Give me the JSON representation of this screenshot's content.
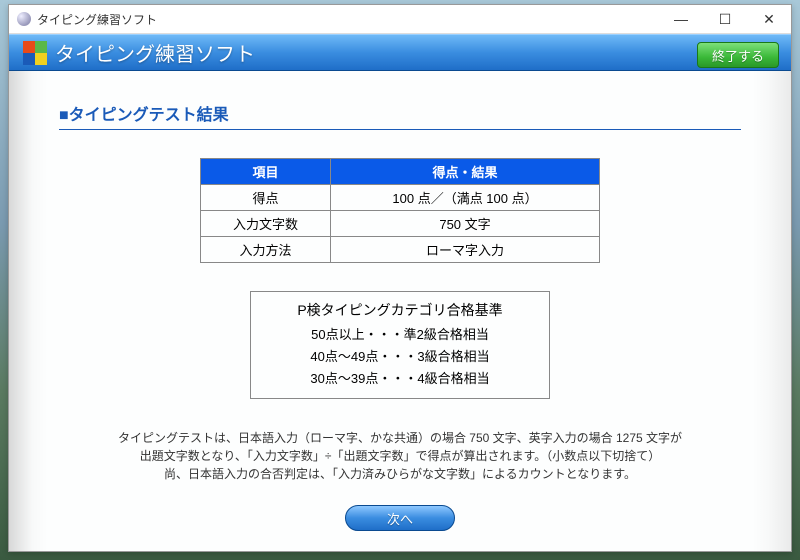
{
  "window": {
    "title": "タイピング練習ソフト"
  },
  "header": {
    "title": "タイピング練習ソフト",
    "exit_label": "終了する"
  },
  "section": {
    "title": "■タイピングテスト結果"
  },
  "result_table": {
    "head_item": "項目",
    "head_score": "得点・結果",
    "rows": [
      {
        "item": "得点",
        "value": "100 点／（満点 100 点）"
      },
      {
        "item": "入力文字数",
        "value": "750 文字"
      },
      {
        "item": "入力方法",
        "value": "ローマ字入力"
      }
    ]
  },
  "criteria": {
    "title": "P検タイピングカテゴリ合格基準",
    "lines": [
      "50点以上・・・準2級合格相当",
      "40点～49点・・・3級合格相当",
      "30点～39点・・・4級合格相当"
    ]
  },
  "note": {
    "line1": "タイピングテストは、日本語入力（ローマ字、かな共通）の場合 750 文字、英字入力の場合 1275 文字が",
    "line2": "出題文字数となり、「入力文字数」÷「出題文字数」で得点が算出されます。（小数点以下切捨て）",
    "line3": "尚、日本語入力の合否判定は、「入力済みひらがな文字数」によるカウントとなります。"
  },
  "buttons": {
    "next": "次へ"
  }
}
